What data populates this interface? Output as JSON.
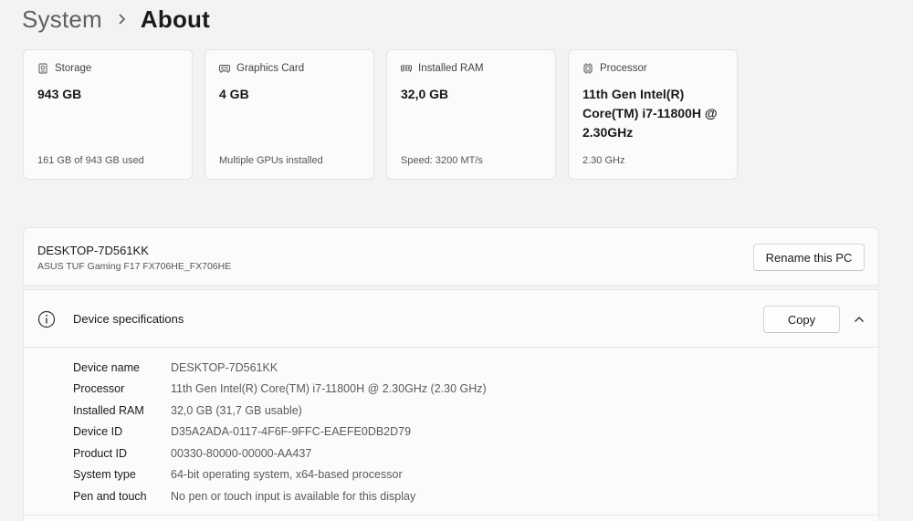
{
  "breadcrumb": {
    "parent": "System",
    "current": "About"
  },
  "cards": [
    {
      "icon": "storage-icon",
      "label": "Storage",
      "value": "943 GB",
      "sub": "161 GB of 943 GB used"
    },
    {
      "icon": "graphics-card-icon",
      "label": "Graphics Card",
      "value": "4 GB",
      "sub": "Multiple GPUs installed"
    },
    {
      "icon": "ram-icon",
      "label": "Installed RAM",
      "value": "32,0 GB",
      "sub": "Speed: 3200 MT/s"
    },
    {
      "icon": "processor-icon",
      "label": "Processor",
      "value": "11th Gen Intel(R) Core(TM) i7-11800H @ 2.30GHz",
      "sub": "2.30 GHz"
    }
  ],
  "pc": {
    "name": "DESKTOP-7D561KK",
    "model": "ASUS TUF Gaming F17 FX706HE_FX706HE",
    "rename_label": "Rename this PC"
  },
  "device_specs": {
    "title": "Device specifications",
    "copy_label": "Copy",
    "rows": [
      {
        "label": "Device name",
        "value": "DESKTOP-7D561KK"
      },
      {
        "label": "Processor",
        "value": "11th Gen Intel(R) Core(TM) i7-11800H @ 2.30GHz (2.30 GHz)"
      },
      {
        "label": "Installed RAM",
        "value": "32,0 GB (31,7 GB usable)"
      },
      {
        "label": "Device ID",
        "value": "D35A2ADA-0117-4F6F-9FFC-EAEFE0DB2D79"
      },
      {
        "label": "Product ID",
        "value": "00330-80000-00000-AA437"
      },
      {
        "label": "System type",
        "value": "64-bit operating system, x64-based processor"
      },
      {
        "label": "Pen and touch",
        "value": "No pen or touch input is available for this display"
      }
    ]
  }
}
